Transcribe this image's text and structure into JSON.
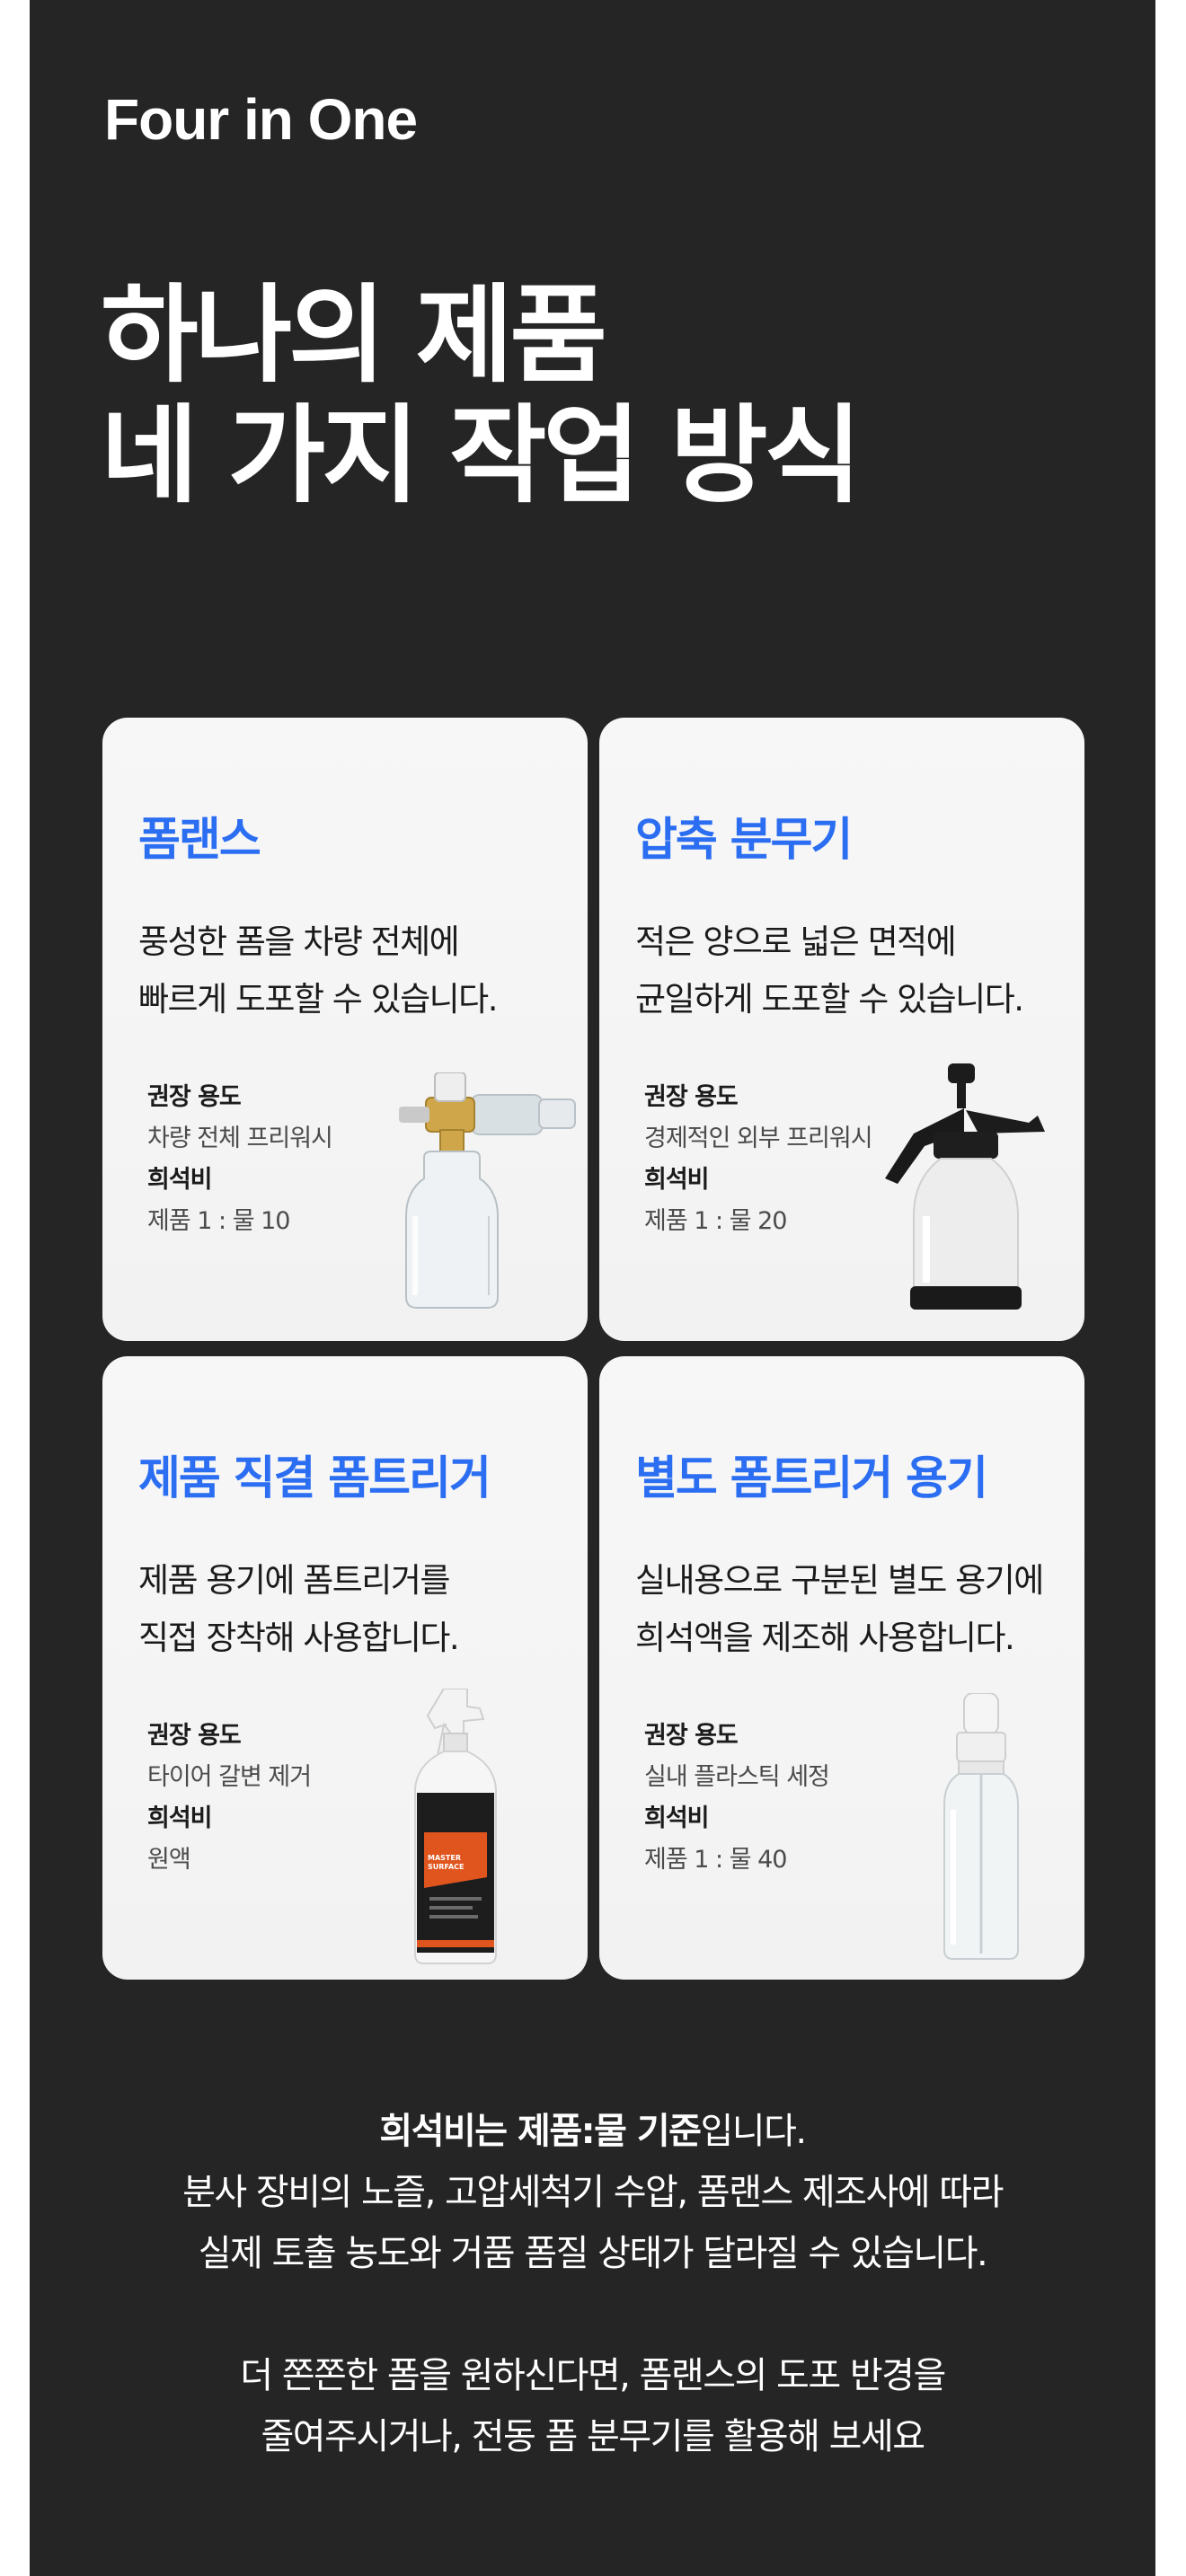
{
  "brand": "Four in One",
  "headline": {
    "line1": "하나의 제품",
    "line2": "네 가지 작업 방식"
  },
  "cards": [
    {
      "title": "폼랜스",
      "desc1": "풍성한 폼을 차량 전체에",
      "desc2": "빠르게 도포할 수 있습니다.",
      "use_label": "권장 용도",
      "use_value": "차량 전체 프리워시",
      "ratio_label": "희석비",
      "ratio_value": "제품 1 : 물 10",
      "image": "foam-lance"
    },
    {
      "title": "압축 분무기",
      "desc1": "적은 양으로 넓은 면적에",
      "desc2": "균일하게 도포할 수 있습니다.",
      "use_label": "권장 용도",
      "use_value": "경제적인 외부 프리워시",
      "ratio_label": "희석비",
      "ratio_value": "제품 1 : 물 20",
      "image": "pressure-sprayer"
    },
    {
      "title": "제품 직결 폼트리거",
      "desc1": "제품 용기에 폼트리거를",
      "desc2": "직접 장착해 사용합니다.",
      "use_label": "권장 용도",
      "use_value": "타이어 갈변 제거",
      "ratio_label": "희석비",
      "ratio_value": "원액",
      "image": "product-bottle-trigger"
    },
    {
      "title": "별도 폼트리거 용기",
      "desc1": "실내용으로 구분된 별도 용기에",
      "desc2": "희석액을 제조해 사용합니다.",
      "use_label": "권장 용도",
      "use_value": "실내 플라스틱 세정",
      "ratio_label": "희석비",
      "ratio_value": "제품 1 : 물 40",
      "image": "foam-pump-bottle"
    }
  ],
  "product_label": {
    "line1": "MASTER",
    "line2": "SURFACE"
  },
  "footer": {
    "line1_bold": "희석비는 제품:물 기준",
    "line1_rest": "입니다.",
    "line2": "분사 장비의 노즐, 고압세척기 수압, 폼랜스 제조사에 따라",
    "line3": "실제 토출 농도와 거품 폼질 상태가 달라질 수 있습니다.",
    "line4": "더 쫀쫀한 폼을 원하신다면, 폼랜스의 도포 반경을",
    "line5": "줄여주시거나, 전동 폼 분무기를 활용해 보세요"
  },
  "colors": {
    "background": "#252525",
    "accent": "#2b6ef2",
    "card": "#f5f5f5"
  }
}
